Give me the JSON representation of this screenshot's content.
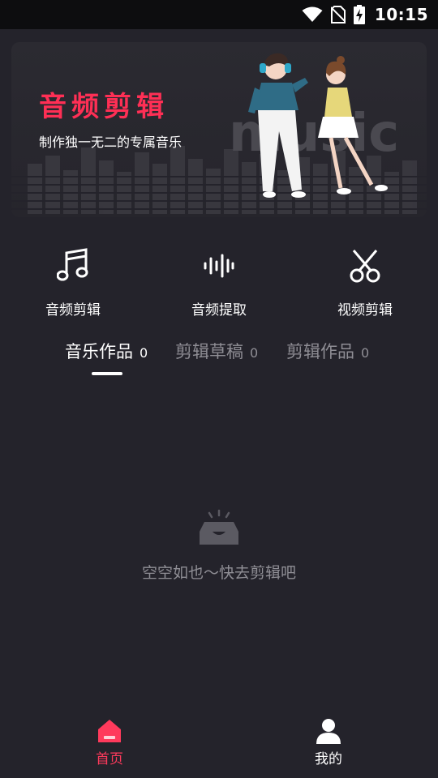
{
  "status_bar": {
    "time": "10:15",
    "icons": [
      "wifi-icon",
      "no-sim-icon",
      "battery-charging-icon"
    ]
  },
  "banner": {
    "title": "音频剪辑",
    "subtitle": "制作独一无二的专属音乐",
    "art_text": "music",
    "title_color": "#ff2f55"
  },
  "features": [
    {
      "icon": "music-note-icon",
      "label": "音频剪辑"
    },
    {
      "icon": "waveform-icon",
      "label": "音频提取"
    },
    {
      "icon": "scissors-icon",
      "label": "视频剪辑"
    }
  ],
  "tabs": [
    {
      "label": "音乐作品",
      "count": "0",
      "active": true
    },
    {
      "label": "剪辑草稿",
      "count": "0",
      "active": false
    },
    {
      "label": "剪辑作品",
      "count": "0",
      "active": false
    }
  ],
  "empty_state": {
    "icon": "empty-box-icon",
    "text": "空空如也～快去剪辑吧"
  },
  "bottom_nav": [
    {
      "icon": "home-icon",
      "label": "首页",
      "active": true,
      "color": "#ff3a5c"
    },
    {
      "icon": "person-icon",
      "label": "我的",
      "active": false,
      "color": "#ffffff"
    }
  ],
  "colors": {
    "background": "#24232b",
    "accent": "#ff3a5c",
    "inactive_text": "#8f8e95"
  }
}
